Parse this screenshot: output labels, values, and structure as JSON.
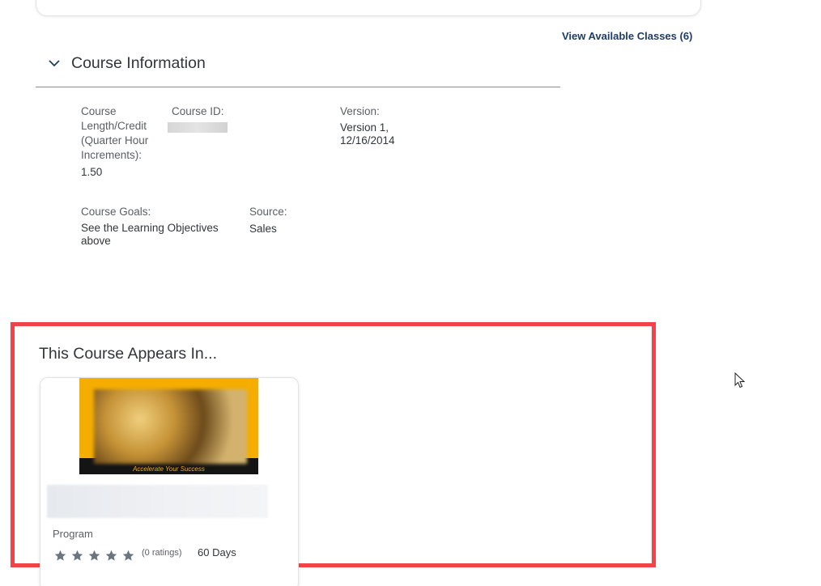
{
  "links": {
    "view_classes": "View Available Classes (6)"
  },
  "course_info": {
    "title": "Course Information",
    "length_label": "Course\nLength/Credit\n(Quarter Hour\nIncrements):",
    "length_value": "1.50",
    "id_label": "Course ID:",
    "version_label": "Version:",
    "version_value": "Version 1,\n12/16/2014",
    "goals_label": "Course Goals:",
    "goals_value": "See the Learning Objectives\nabove",
    "source_label": "Source:",
    "source_value": "Sales"
  },
  "appears_in": {
    "title": "This Course Appears In...",
    "card": {
      "thumb_tagline": "Accelerate Your Success",
      "type": "Program",
      "rating_stars": 5,
      "rating_value": 0,
      "ratings_text": "(0 ratings)",
      "duration": "60 Days"
    }
  },
  "colors": {
    "link": "#1d3c68",
    "highlight_border": "#f0444a",
    "thumb_bg": "#f5ad00",
    "star": "#6a7580"
  },
  "icons": {
    "section_toggle": "chevron-down-icon",
    "rating": "star-icon",
    "pointer": "mouse-cursor-icon"
  }
}
